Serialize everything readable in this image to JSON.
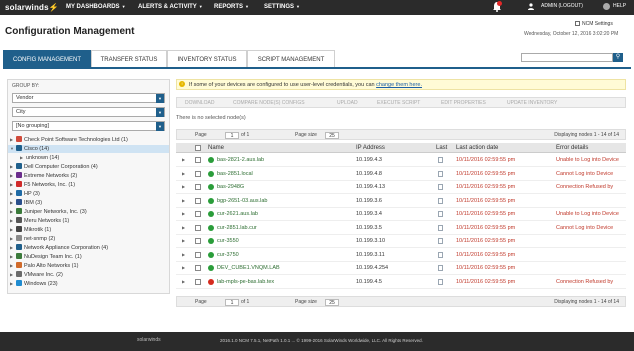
{
  "topbar": {
    "logo": "solarwinds",
    "nav": [
      "MY DASHBOARDS",
      "ALERTS & ACTIVITY",
      "REPORTS",
      "SETTINGS"
    ],
    "user": "ADMIN (LOGOUT)",
    "help": "HELP"
  },
  "header": {
    "title": "Configuration Management",
    "ncm_settings": "NCM Settings",
    "date": "Wednesday, October 12, 2016 3:02:20 PM"
  },
  "tabs": [
    "CONFIG MANAGEMENT",
    "TRANSFER STATUS",
    "INVENTORY STATUS",
    "SCRIPT MANAGEMENT"
  ],
  "group_by": {
    "label": "GROUP BY:",
    "selects": [
      "Vendor",
      "City",
      "[No grouping]"
    ]
  },
  "tree": [
    {
      "label": "Check Point Software Technologies Ltd (1)",
      "indent": 0,
      "expanded": false,
      "color": "#d04a3a"
    },
    {
      "label": "Cisco (14)",
      "indent": 0,
      "expanded": true,
      "selected": true,
      "color": "#1f5f8b"
    },
    {
      "label": "unknown (14)",
      "indent": 1,
      "expanded": false,
      "color": ""
    },
    {
      "label": "Dell Computer Corporation (4)",
      "indent": 0,
      "expanded": false,
      "color": "#1f5f8b"
    },
    {
      "label": "Extreme Networks (2)",
      "indent": 0,
      "expanded": false,
      "color": "#6a2c8b"
    },
    {
      "label": "F5 Networks, Inc. (1)",
      "indent": 0,
      "expanded": false,
      "color": "#d02a2a"
    },
    {
      "label": "HP (3)",
      "indent": 0,
      "expanded": false,
      "color": "#1f6aa5"
    },
    {
      "label": "IBM (3)",
      "indent": 0,
      "expanded": false,
      "color": "#2a4f8b"
    },
    {
      "label": "Juniper Networks, Inc. (3)",
      "indent": 0,
      "expanded": false,
      "color": "#3a7a3a"
    },
    {
      "label": "Meru Networks (1)",
      "indent": 0,
      "expanded": false,
      "color": "#555555"
    },
    {
      "label": "Mikrotik (1)",
      "indent": 0,
      "expanded": false,
      "color": "#444444"
    },
    {
      "label": "net-snmp (2)",
      "indent": 0,
      "expanded": false,
      "color": "#8a8a8a"
    },
    {
      "label": "Network Appliance Corporation (4)",
      "indent": 0,
      "expanded": false,
      "color": "#1f5f8b"
    },
    {
      "label": "NuDesign Team Inc. (1)",
      "indent": 0,
      "expanded": false,
      "color": "#3a7a3a"
    },
    {
      "label": "Palo Alto Networks (1)",
      "indent": 0,
      "expanded": false,
      "color": "#d06a2a"
    },
    {
      "label": "VMware Inc. (2)",
      "indent": 0,
      "expanded": false,
      "color": "#6a6a6a"
    },
    {
      "label": "Windows (23)",
      "indent": 0,
      "expanded": false,
      "color": "#1f8bd0"
    }
  ],
  "notice": {
    "text": "If some of your devices are configured to use user-level credentials, you can",
    "link": "change them here."
  },
  "toolbar": [
    "DOWNLOAD",
    "COMPARE NODE(S) CONFIGS",
    "UPLOAD",
    "EXECUTE SCRIPT",
    "EDIT PROPERTIES",
    "UPDATE INVENTORY"
  ],
  "selection_text": "There is no selected node(s)",
  "pager": {
    "page_label": "Page",
    "page_value": "1",
    "of_label": "of 1",
    "size_label": "Page size",
    "size_value": "25",
    "display": "Displaying nodes 1 - 14 of 14"
  },
  "columns": {
    "name": "Name",
    "ip": "IP Address",
    "last": "Last",
    "action": "Last action date",
    "error": "Error details"
  },
  "rows": [
    {
      "name": "bas-2821-2.aus.lab",
      "ip": "10.199.4.3",
      "date": "10/11/2016 02:59:55 pm",
      "error": "Unable to Log into Device",
      "status": "up"
    },
    {
      "name": "bas-2851.local",
      "ip": "10.199.4.8",
      "date": "10/11/2016 02:59:55 pm",
      "error": "Cannot Log into Device",
      "status": "up"
    },
    {
      "name": "bas-2948G",
      "ip": "10.199.4.13",
      "date": "10/11/2016 02:59:55 pm",
      "error": "Connection Refused by",
      "status": "up"
    },
    {
      "name": "bgp-2651-03.aus.lab",
      "ip": "10.199.3.6",
      "date": "10/11/2016 02:59:55 pm",
      "error": "",
      "status": "up"
    },
    {
      "name": "cur-2621.aus.lab",
      "ip": "10.199.3.4",
      "date": "10/11/2016 02:59:55 pm",
      "error": "Unable to Log into Device",
      "status": "up"
    },
    {
      "name": "cur-2851.lab.cur",
      "ip": "10.199.3.5",
      "date": "10/11/2016 02:59:55 pm",
      "error": "Cannot Log into Device",
      "status": "up"
    },
    {
      "name": "cur-3550",
      "ip": "10.199.3.10",
      "date": "10/11/2016 02:59:55 pm",
      "error": "",
      "status": "up"
    },
    {
      "name": "cur-3750",
      "ip": "10.199.3.11",
      "date": "10/11/2016 02:59:55 pm",
      "error": "",
      "status": "up"
    },
    {
      "name": "DEV_CUBE1.VNQM.LAB",
      "ip": "10.199.4.254",
      "date": "10/11/2016 02:59:55 pm",
      "error": "",
      "status": "up"
    },
    {
      "name": "lab-mpls-pe-bas.lab.tex",
      "ip": "10.199.4.5",
      "date": "10/11/2016 02:59:55 pm",
      "error": "Connection Refused by",
      "status": "down"
    }
  ],
  "footer": "2016.1.0 NCM 7.5.1, NetPath 1.0.1 ... © 1999-2016 SolarWinds Worldwide, LLC. All Rights Reserved."
}
